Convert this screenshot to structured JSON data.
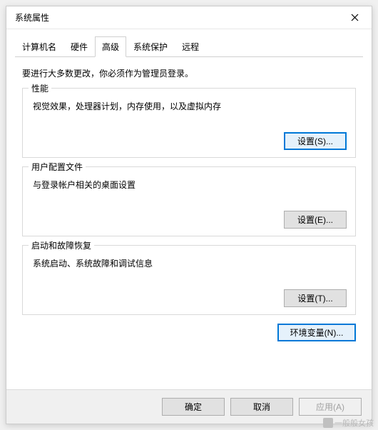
{
  "window": {
    "title": "系统属性"
  },
  "tabs": {
    "computer_name": "计算机名",
    "hardware": "硬件",
    "advanced": "高级",
    "system_protection": "系统保护",
    "remote": "远程"
  },
  "intro": "要进行大多数更改，你必须作为管理员登录。",
  "groups": {
    "performance": {
      "title": "性能",
      "desc": "视觉效果，处理器计划，内存使用，以及虚拟内存",
      "button": "设置(S)..."
    },
    "user_profiles": {
      "title": "用户配置文件",
      "desc": "与登录帐户相关的桌面设置",
      "button": "设置(E)..."
    },
    "startup": {
      "title": "启动和故障恢复",
      "desc": "系统启动、系统故障和调试信息",
      "button": "设置(T)..."
    }
  },
  "env_button": "环境变量(N)...",
  "bottom": {
    "ok": "确定",
    "cancel": "取消",
    "apply": "应用(A)"
  },
  "watermark": "一般般女孩"
}
